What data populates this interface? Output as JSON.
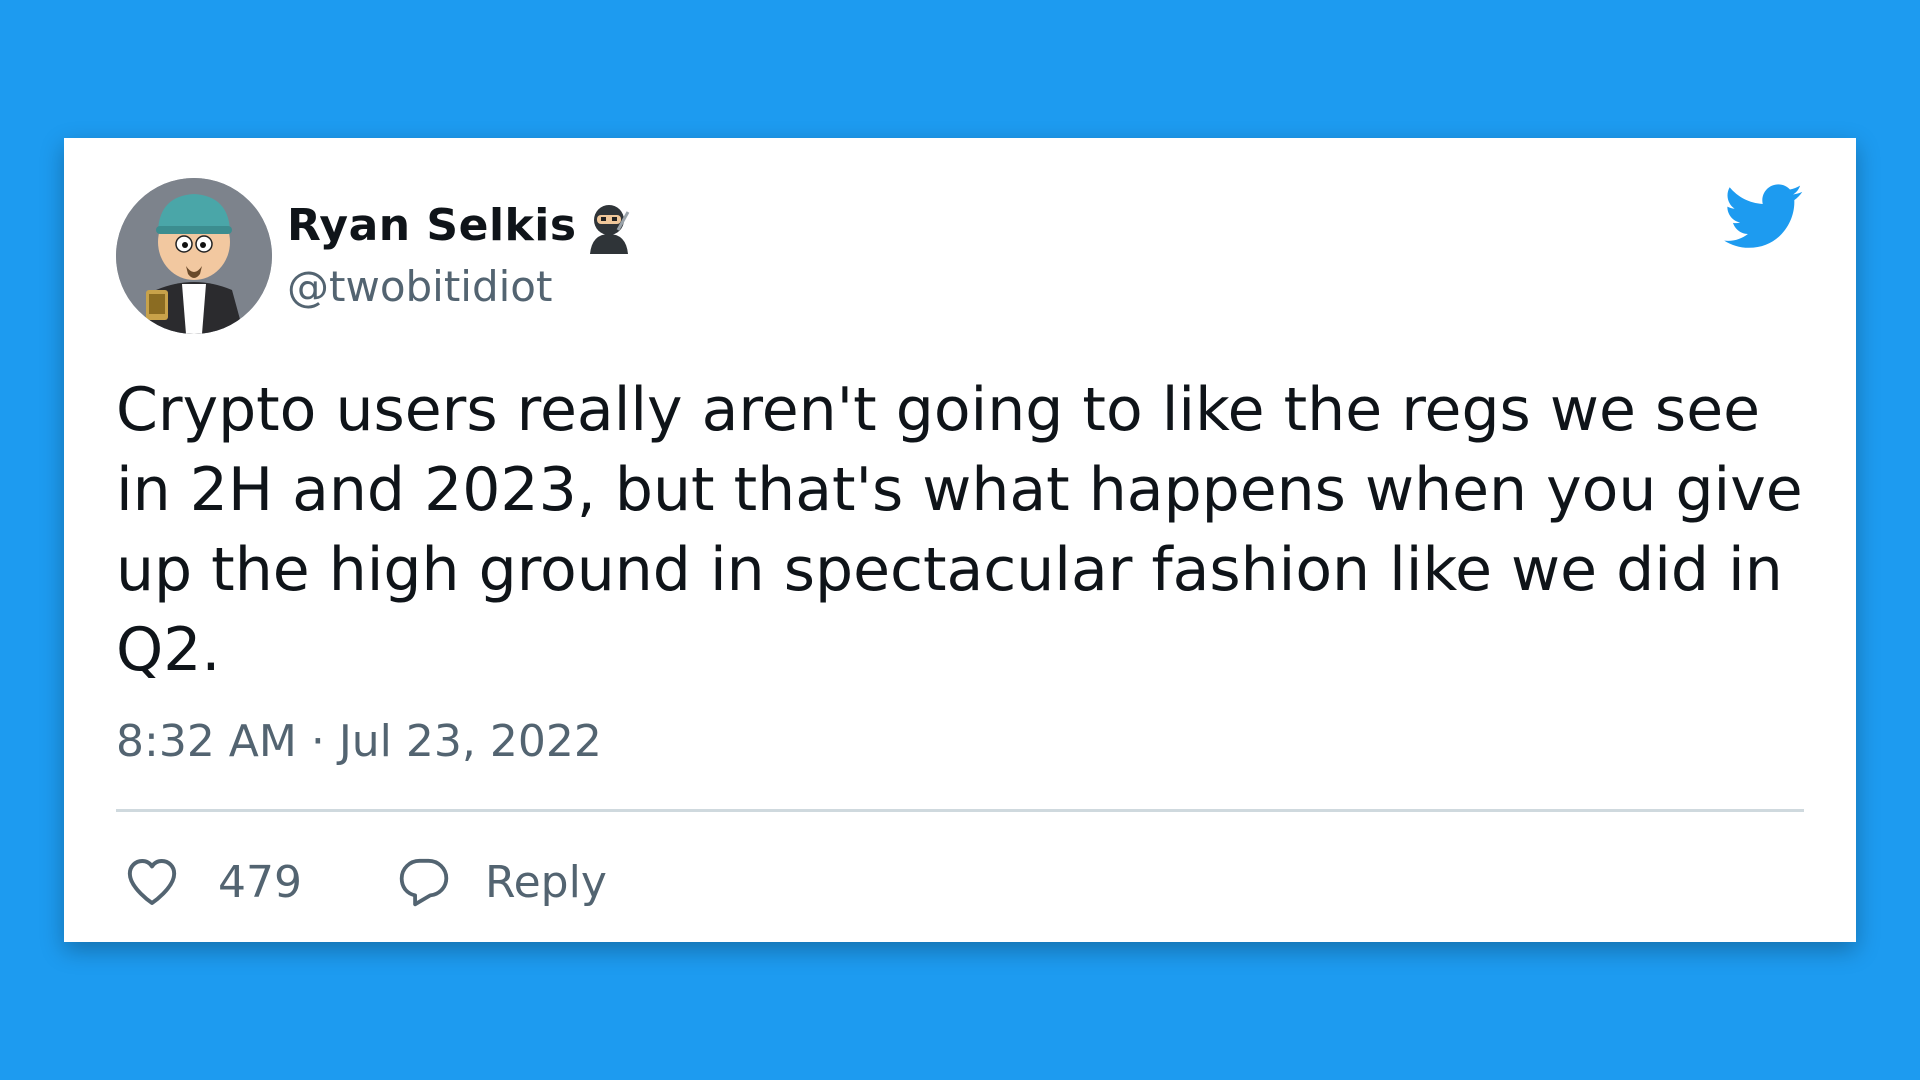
{
  "background_color": "#1d9bf0",
  "tweet": {
    "author": {
      "name": "Ryan Selkis",
      "handle": "@twobitidiot",
      "name_emoji": "ninja-icon",
      "avatar": "cartoon-avatar"
    },
    "text": "Crypto users really aren't going to like the regs we see in 2H and 2023, but that's what happens when you give up the high ground in spectacular fashion like we did in Q2.",
    "timestamp": "8:32 AM · Jul 23, 2022",
    "actions": {
      "like_count": "479",
      "reply_label": "Reply"
    },
    "brand_icon": "twitter-bird-icon",
    "brand_color": "#1d9bf0"
  }
}
